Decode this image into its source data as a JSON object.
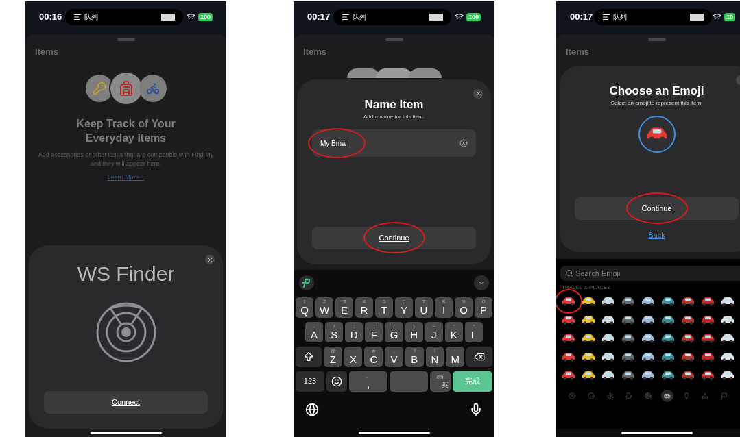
{
  "screens": [
    {
      "status_bar": {
        "time": "00:16",
        "activity": "队列",
        "battery": "100"
      },
      "sheet_title": "Items",
      "empty_state": {
        "headline": "Keep Track of Your Everyday Items",
        "description": "Add accessories or other items that are compatible with Find My and they will appear here.",
        "link": "Learn More..."
      },
      "dialog": {
        "kind": "connect",
        "title": "WS Finder",
        "button": "Connect",
        "button_highlighted": false
      }
    },
    {
      "status_bar": {
        "time": "00:17",
        "activity": "队列",
        "battery": "100"
      },
      "sheet_title": "Items",
      "dialog": {
        "kind": "name",
        "title": "Name Item",
        "subtitle": "Add a name for this item.",
        "field_value": "My Bmw",
        "field_highlighted": true,
        "button": "Continue",
        "button_highlighted": true
      },
      "keyboard": {
        "rows": [
          [
            {
              "kind": "letter",
              "label": "Q",
              "hint": "1"
            },
            {
              "kind": "letter",
              "label": "W",
              "hint": "2"
            },
            {
              "kind": "letter",
              "label": "E",
              "hint": "3"
            },
            {
              "kind": "letter",
              "label": "R",
              "hint": "4"
            },
            {
              "kind": "letter",
              "label": "T",
              "hint": "5"
            },
            {
              "kind": "letter",
              "label": "Y",
              "hint": "6"
            },
            {
              "kind": "letter",
              "label": "U",
              "hint": "7"
            },
            {
              "kind": "letter",
              "label": "I",
              "hint": "8"
            },
            {
              "kind": "letter",
              "label": "O",
              "hint": "9"
            },
            {
              "kind": "letter",
              "label": "P",
              "hint": "0"
            }
          ],
          [
            {
              "kind": "letter",
              "label": "A",
              "hint": "-"
            },
            {
              "kind": "letter",
              "label": "S",
              "hint": "/"
            },
            {
              "kind": "letter",
              "label": "D",
              "hint": ":"
            },
            {
              "kind": "letter",
              "label": "F",
              "hint": ";"
            },
            {
              "kind": "letter",
              "label": "G",
              "hint": "("
            },
            {
              "kind": "letter",
              "label": "H",
              "hint": ")"
            },
            {
              "kind": "letter",
              "label": "J",
              "hint": "~"
            },
            {
              "kind": "letter",
              "label": "K",
              "hint": "“"
            },
            {
              "kind": "letter",
              "label": "L",
              "hint": "”"
            }
          ],
          [
            {
              "kind": "shift"
            },
            {
              "kind": "letter",
              "label": "Z",
              "hint": "@"
            },
            {
              "kind": "letter",
              "label": "X",
              "hint": "."
            },
            {
              "kind": "letter",
              "label": "C",
              "hint": "#"
            },
            {
              "kind": "letter",
              "label": "V",
              "hint": ","
            },
            {
              "kind": "letter",
              "label": "B",
              "hint": "?"
            },
            {
              "kind": "letter",
              "label": "N",
              "hint": "!"
            },
            {
              "kind": "letter",
              "label": "M",
              "hint": "'"
            },
            {
              "kind": "delete"
            }
          ],
          [
            {
              "kind": "mode",
              "label": "123"
            },
            {
              "kind": "emoji"
            },
            {
              "kind": "letter",
              "label": ",",
              "hint": "。"
            },
            {
              "kind": "space"
            },
            {
              "kind": "lang",
              "label": "中",
              "hint": "英"
            },
            {
              "kind": "return",
              "label": "完成"
            }
          ]
        ]
      }
    },
    {
      "status_bar": {
        "time": "00:17",
        "activity": "队列",
        "battery": "10"
      },
      "sheet_title": "Items",
      "dialog": {
        "kind": "emoji",
        "title": "Choose an Emoji",
        "subtitle": "Select an emoji to represent this item.",
        "button": "Continue",
        "button_highlighted": true,
        "link": "Back"
      },
      "emoji_picker": {
        "placeholder": "Search Emoji",
        "section": "TRAVEL & PLACES",
        "emojis": [
          {
            "highlighted": true
          },
          {
            "highlighted": false
          },
          {
            "highlighted": false
          },
          {
            "highlighted": false
          },
          {
            "highlighted": false
          },
          {
            "highlighted": false
          },
          {
            "highlighted": false
          },
          {
            "highlighted": false
          },
          {
            "highlighted": false
          },
          {
            "highlighted": false
          },
          {
            "highlighted": false
          },
          {
            "highlighted": false
          },
          {
            "highlighted": false
          },
          {
            "highlighted": false
          },
          {
            "highlighted": false
          },
          {
            "highlighted": false
          },
          {
            "highlighted": false
          },
          {
            "highlighted": false
          },
          {
            "highlighted": false
          },
          {
            "highlighted": false
          },
          {
            "highlighted": false
          },
          {
            "highlighted": false
          },
          {
            "highlighted": false
          },
          {
            "highlighted": false
          },
          {
            "highlighted": false
          },
          {
            "highlighted": false
          },
          {
            "highlighted": false
          },
          {
            "highlighted": false
          },
          {
            "highlighted": false
          },
          {
            "highlighted": false
          },
          {
            "highlighted": false
          },
          {
            "highlighted": false
          },
          {
            "highlighted": false
          },
          {
            "highlighted": false
          },
          {
            "highlighted": false
          },
          {
            "highlighted": false
          },
          {
            "highlighted": false
          },
          {
            "highlighted": false
          },
          {
            "highlighted": false
          },
          {
            "highlighted": false
          },
          {
            "highlighted": false
          },
          {
            "highlighted": false
          },
          {
            "highlighted": false
          },
          {
            "highlighted": false
          },
          {
            "highlighted": false
          }
        ],
        "categories": [
          {
            "selected": false
          },
          {
            "selected": false
          },
          {
            "selected": false
          },
          {
            "selected": false
          },
          {
            "selected": false
          },
          {
            "selected": true
          },
          {
            "selected": false
          },
          {
            "selected": false
          },
          {
            "selected": false
          }
        ]
      }
    }
  ]
}
